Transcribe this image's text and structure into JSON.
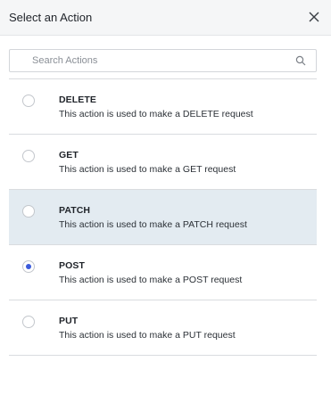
{
  "header": {
    "title": "Select an Action"
  },
  "search": {
    "placeholder": "Search Actions",
    "value": ""
  },
  "actions": [
    {
      "name": "DELETE",
      "description": "This action is used to make a DELETE request",
      "selected": false,
      "highlighted": false
    },
    {
      "name": "GET",
      "description": "This action is used to make a GET request",
      "selected": false,
      "highlighted": false
    },
    {
      "name": "PATCH",
      "description": "This action is used to make a PATCH request",
      "selected": false,
      "highlighted": true
    },
    {
      "name": "POST",
      "description": "This action is used to make a POST request",
      "selected": true,
      "highlighted": false
    },
    {
      "name": "PUT",
      "description": "This action is used to make a PUT request",
      "selected": false,
      "highlighted": false
    }
  ],
  "colors": {
    "header_bg": "#f5f6f7",
    "highlight_bg": "#e3ebf1",
    "radio_accent": "#3b5bdb"
  },
  "icons": {
    "close": "close-icon",
    "search": "search-icon"
  }
}
